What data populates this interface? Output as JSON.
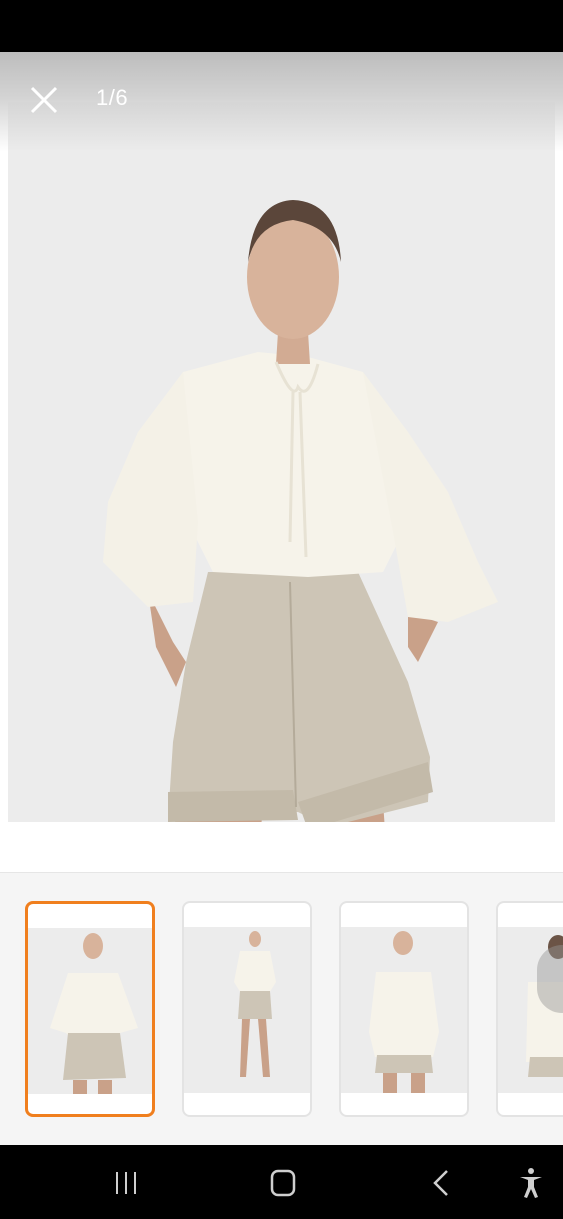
{
  "viewer": {
    "counter": "1/6",
    "current_index": 1,
    "total_images": 6
  },
  "icons": {
    "close": "close-icon",
    "recent_apps": "recent-apps-icon",
    "home": "home-icon",
    "back": "back-icon",
    "accessibility": "accessibility-icon"
  },
  "thumbnails": [
    {
      "label": "image-1",
      "selected": true
    },
    {
      "label": "image-2",
      "selected": false
    },
    {
      "label": "image-3",
      "selected": false
    },
    {
      "label": "image-4",
      "selected": false
    }
  ],
  "colors": {
    "selected_border": "#f07f1e",
    "blouse": "#f6f3ea",
    "shorts": "#cdc5b6",
    "background": "#ececec"
  }
}
